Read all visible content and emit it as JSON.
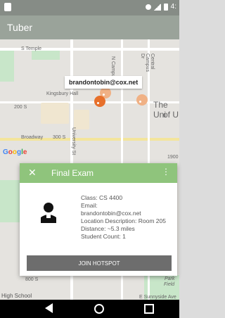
{
  "status_bar": {
    "time": "4:"
  },
  "app": {
    "title": "Tuber"
  },
  "map": {
    "labels": {
      "temple": "S Temple",
      "kingsbury": "Kingsbury Hall",
      "street_200": "200 S",
      "street_300": "300 S",
      "broadway": "Broadway",
      "the_uni": "The Uni",
      "of_u": "of U",
      "campus_dr": "N Campus Dr",
      "central_campus": "Central Campus Dr",
      "university": "University St",
      "s_1900": "1900",
      "high_school": "High School",
      "e_sunnyside": "E Sunnyside Ave",
      "park": "Park",
      "field": "Field",
      "s_800": "800 S"
    },
    "callout_email": "brandontobin@cox.net",
    "google_logo": "Google"
  },
  "dialog": {
    "title": "Final Exam",
    "class": "Class: CS 4400",
    "email_label": "Email:",
    "email_value": "brandontobin@cox.net",
    "location": "Location Description: Room 205",
    "distance": "Distance: ~5.3 miles",
    "student_count": "Student Count: 1",
    "join_button": "JOIN HOTSPOT",
    "close_icon": "close-icon",
    "more_icon": "more-vert-icon"
  },
  "nav": {
    "back_icon": "back-icon",
    "home_icon": "home-icon",
    "recent_icon": "recent-apps-icon"
  }
}
